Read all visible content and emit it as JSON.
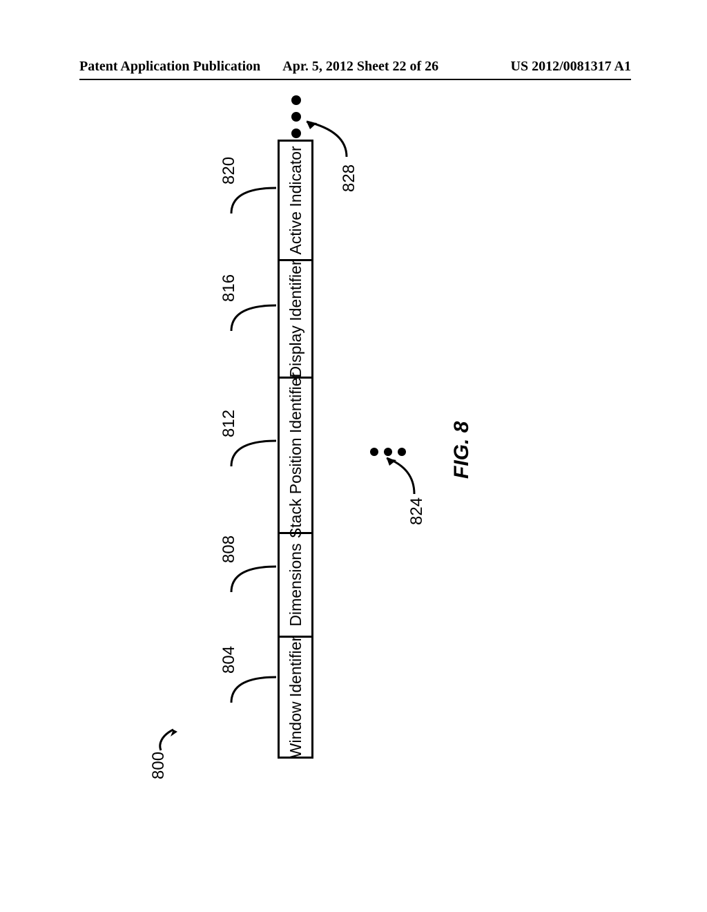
{
  "header": {
    "left": "Patent Application Publication",
    "center": "Apr. 5, 2012  Sheet 22 of 26",
    "right": "US 2012/0081317 A1"
  },
  "figure": {
    "main_ref": "800",
    "caption": "FIG. 8",
    "cells": [
      {
        "ref": "804",
        "label": "Window Identifier"
      },
      {
        "ref": "808",
        "label": "Dimensions"
      },
      {
        "ref": "812",
        "label": "Stack Position Identifier"
      },
      {
        "ref": "816",
        "label": "Display Identifier"
      },
      {
        "ref": "820",
        "label": "Active Indicator"
      }
    ],
    "refs_below": {
      "left": "824",
      "right": "828"
    }
  }
}
